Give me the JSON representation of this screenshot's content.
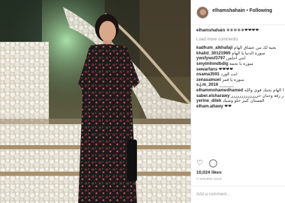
{
  "post": {
    "username": "elhamshahain",
    "dot": "•",
    "follow_label": "Following",
    "caption": "❄❄❄❄❄❤❤❤❤"
  },
  "load_more": "Load more comments",
  "comments": [
    {
      "user": "kadhum_alkhafaji",
      "text": "نجية لك من عشاق الهام"
    },
    {
      "user": "khalid_30121969",
      "text": "منورة الدنيا يا الهام"
    },
    {
      "user": "ywsfywsf3797",
      "text": "انتي اجلس"
    },
    {
      "user": "smylmhmdbdlg",
      "text": "منورة يا نجمة"
    },
    {
      "user": "sewarfans",
      "text": "❤❤❤❤"
    },
    {
      "user": "osama3591",
      "text": "انت الورد"
    },
    {
      "user": "zenasamuel",
      "text": "منورة يا قمر"
    },
    {
      "user": "s.j.m_2016",
      "text": "______"
    },
    {
      "user": "elhammohamedhamed",
      "text": "عفاالك يا الهام بحبك قوي والله"
    },
    {
      "user": "saber.elsharawy",
      "text": "حارررررررررررررررر رقة وحنان حررررررررررررر"
    },
    {
      "user": "yerine_dilek",
      "text": "الفستان كتير حلو وشيك"
    },
    {
      "user": "elham.altawy",
      "text": "❤❤"
    }
  ],
  "likes": "10,024 likes",
  "time_ago": "7 HOURS AGO",
  "add_comment_placeholder": "Add a comment...",
  "icons": {
    "like": "heart-icon",
    "comment": "comment-icon"
  }
}
